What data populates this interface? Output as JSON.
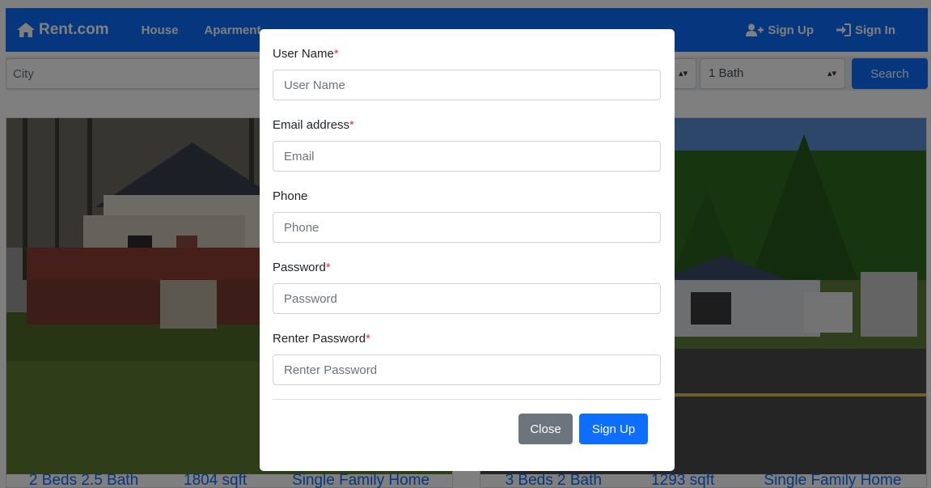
{
  "navbar": {
    "brand": "Rent.com",
    "links": [
      "House",
      "Aparment"
    ],
    "signup": "Sign Up",
    "signin": "Sign In"
  },
  "search": {
    "city_placeholder": "City",
    "beds_value": "",
    "bath_value": "1 Bath",
    "button": "Search"
  },
  "listings": [
    {
      "beds_bath": "2 Beds 2.5 Bath",
      "sqft": "1804 sqft",
      "type": "Single Family Home"
    },
    {
      "beds_bath": "3 Beds 2 Bath",
      "sqft": "1293 sqft",
      "type": "Single Family Home"
    }
  ],
  "modal": {
    "fields": [
      {
        "label": "User Name",
        "required": true,
        "placeholder": "User Name"
      },
      {
        "label": "Email address",
        "required": true,
        "placeholder": "Email"
      },
      {
        "label": "Phone",
        "required": false,
        "placeholder": "Phone"
      },
      {
        "label": "Password",
        "required": true,
        "placeholder": "Password"
      },
      {
        "label": "Renter Password",
        "required": true,
        "placeholder": "Renter Password"
      }
    ],
    "required_mark": "*",
    "close_button": "Close",
    "signup_button": "Sign Up"
  },
  "colors": {
    "primary": "#0d6efd",
    "secondary": "#6c757d",
    "required": "#dc3545"
  }
}
